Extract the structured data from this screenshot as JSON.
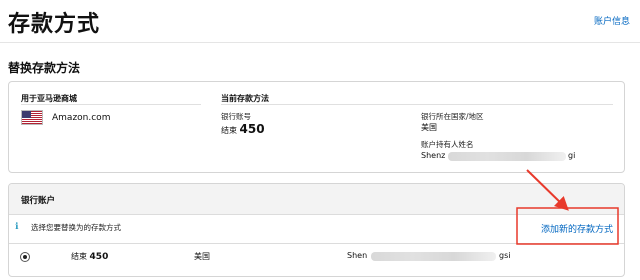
{
  "page": {
    "title": "存款方式",
    "account_info_link": "账户信息"
  },
  "section": {
    "title": "替换存款方法"
  },
  "current": {
    "for_label": "用于亚马逊商城",
    "marketplace": "Amazon.com",
    "current_method_label": "当前存款方法",
    "account_number_label": "银行账号",
    "account_number_value": "结束 450",
    "bank_country_label": "银行所在国家/地区",
    "bank_country_value": "美国",
    "holder_name_label": "账户持有人姓名",
    "holder_name_visible": "Shenz",
    "holder_name_tail": "gi"
  },
  "bank_accounts": {
    "header": "银行账户",
    "hint": "选择您要替换为的存款方式",
    "add_link": "添加新的存款方式",
    "rows": [
      {
        "ending": "结束 450",
        "country": "美国",
        "name_visible": "Shen",
        "name_tail": "gsi"
      }
    ]
  },
  "colors": {
    "link": "#0066c0",
    "annotation_arrow": "#e8392b",
    "info_icon": "#2a9bc0"
  }
}
